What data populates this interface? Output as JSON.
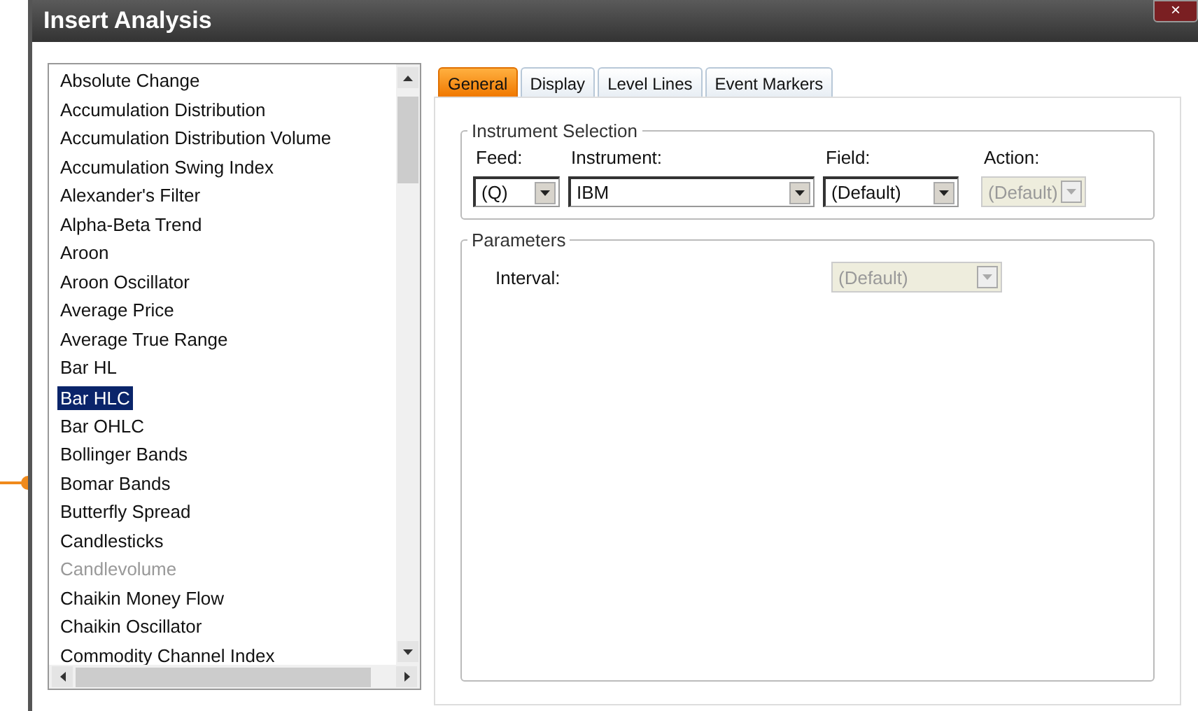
{
  "window": {
    "title": "Insert Analysis",
    "close": "×"
  },
  "analyses": [
    {
      "label": "Absolute Change",
      "selected": false,
      "disabled": false
    },
    {
      "label": "Accumulation Distribution",
      "selected": false,
      "disabled": false
    },
    {
      "label": "Accumulation Distribution Volume",
      "selected": false,
      "disabled": false
    },
    {
      "label": "Accumulation Swing Index",
      "selected": false,
      "disabled": false
    },
    {
      "label": "Alexander's Filter",
      "selected": false,
      "disabled": false
    },
    {
      "label": "Alpha-Beta Trend",
      "selected": false,
      "disabled": false
    },
    {
      "label": "Aroon",
      "selected": false,
      "disabled": false
    },
    {
      "label": "Aroon Oscillator",
      "selected": false,
      "disabled": false
    },
    {
      "label": "Average Price",
      "selected": false,
      "disabled": false
    },
    {
      "label": "Average True Range",
      "selected": false,
      "disabled": false
    },
    {
      "label": "Bar HL",
      "selected": false,
      "disabled": false
    },
    {
      "label": "Bar HLC",
      "selected": true,
      "disabled": false
    },
    {
      "label": "Bar OHLC",
      "selected": false,
      "disabled": false
    },
    {
      "label": "Bollinger Bands",
      "selected": false,
      "disabled": false
    },
    {
      "label": "Bomar Bands",
      "selected": false,
      "disabled": false
    },
    {
      "label": "Butterfly Spread",
      "selected": false,
      "disabled": false
    },
    {
      "label": "Candlesticks",
      "selected": false,
      "disabled": false
    },
    {
      "label": "Candlevolume",
      "selected": false,
      "disabled": true
    },
    {
      "label": "Chaikin Money Flow",
      "selected": false,
      "disabled": false
    },
    {
      "label": "Chaikin Oscillator",
      "selected": false,
      "disabled": false
    },
    {
      "label": "Commodity Channel Index",
      "selected": false,
      "disabled": false
    }
  ],
  "tabs": [
    {
      "label": "General",
      "selected": true
    },
    {
      "label": "Display",
      "selected": false
    },
    {
      "label": "Level Lines",
      "selected": false
    },
    {
      "label": "Event Markers",
      "selected": false
    }
  ],
  "instrument_selection": {
    "title": "Instrument Selection",
    "fields": [
      {
        "label": "Feed:",
        "value": "(Q)",
        "disabled": false
      },
      {
        "label": "Instrument:",
        "value": "IBM",
        "disabled": false
      },
      {
        "label": "Field:",
        "value": "(Default)",
        "disabled": false
      },
      {
        "label": "Action:",
        "value": "(Default)",
        "disabled": true
      }
    ]
  },
  "parameters": {
    "title": "Parameters",
    "fields": [
      {
        "label": "Interval:",
        "value": "(Default)",
        "disabled": true
      }
    ]
  }
}
